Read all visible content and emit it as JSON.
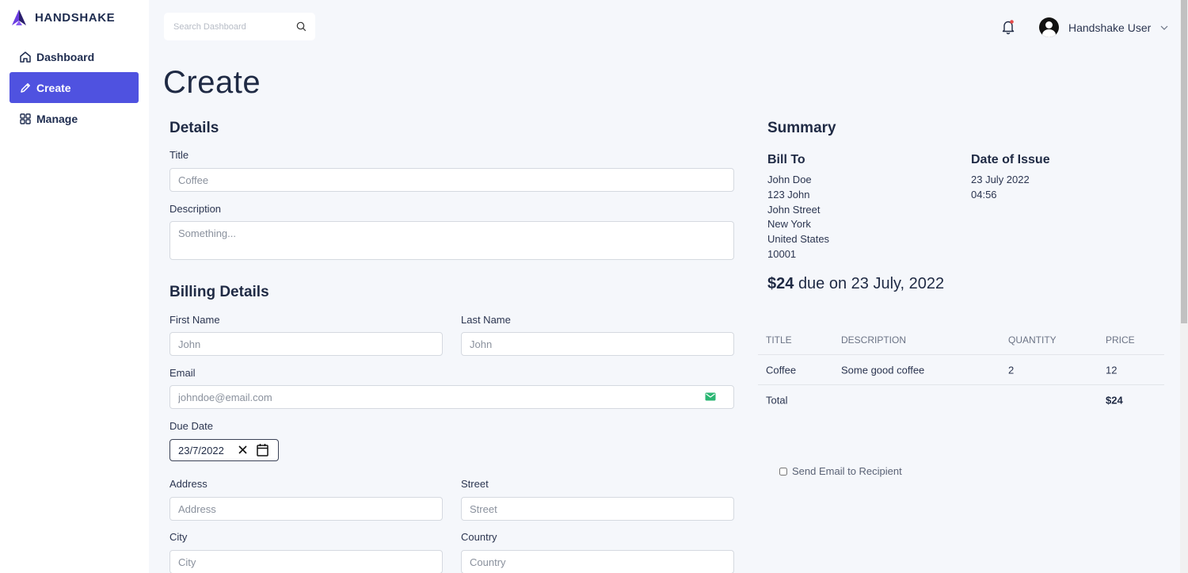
{
  "app": {
    "name": "HANDSHAKE"
  },
  "sidebar": {
    "items": [
      {
        "label": "Dashboard",
        "icon": "home-icon"
      },
      {
        "label": "Create",
        "icon": "pencil-icon",
        "active": true
      },
      {
        "label": "Manage",
        "icon": "grid-icon"
      }
    ]
  },
  "header": {
    "search_placeholder": "Search Dashboard",
    "user_name": "Handshake User"
  },
  "page": {
    "title": "Create"
  },
  "details": {
    "heading": "Details",
    "title_label": "Title",
    "title_placeholder": "Coffee",
    "description_label": "Description",
    "description_placeholder": "Something..."
  },
  "billing": {
    "heading": "Billing Details",
    "first_name_label": "First Name",
    "first_name_placeholder": "John",
    "last_name_label": "Last Name",
    "last_name_placeholder": "John",
    "email_label": "Email",
    "email_placeholder": "johndoe@email.com",
    "due_date_label": "Due Date",
    "due_date_value": "23/7/2022",
    "address_label": "Address",
    "address_placeholder": "Address",
    "street_label": "Street",
    "street_placeholder": "Street",
    "city_label": "City",
    "city_placeholder": "City",
    "country_label": "Country",
    "country_placeholder": "Country"
  },
  "summary": {
    "heading": "Summary",
    "bill_to_label": "Bill To",
    "bill_to_lines": [
      "John Doe",
      "123 John",
      "John Street",
      "New York",
      "United States",
      "10001"
    ],
    "date_label": "Date of Issue",
    "date_value": "23 July 2022",
    "time_value": "04:56",
    "due_amount": "$24",
    "due_text": "due on 23 July, 2022",
    "table": {
      "headers": [
        "TITLE",
        "DESCRIPTION",
        "QUANTITY",
        "PRICE"
      ],
      "rows": [
        {
          "title": "Coffee",
          "description": "Some good coffee",
          "quantity": "2",
          "price": "12"
        }
      ],
      "total_label": "Total",
      "total_value": "$24"
    },
    "send_email_label": "Send Email to Recipient",
    "send_email_checked": false
  },
  "colors": {
    "accent": "#4f52e0",
    "text": "#1f2a44",
    "background": "#f5f7fb",
    "email_icon": "#2bb673",
    "bell_dot": "#e64b4b"
  }
}
